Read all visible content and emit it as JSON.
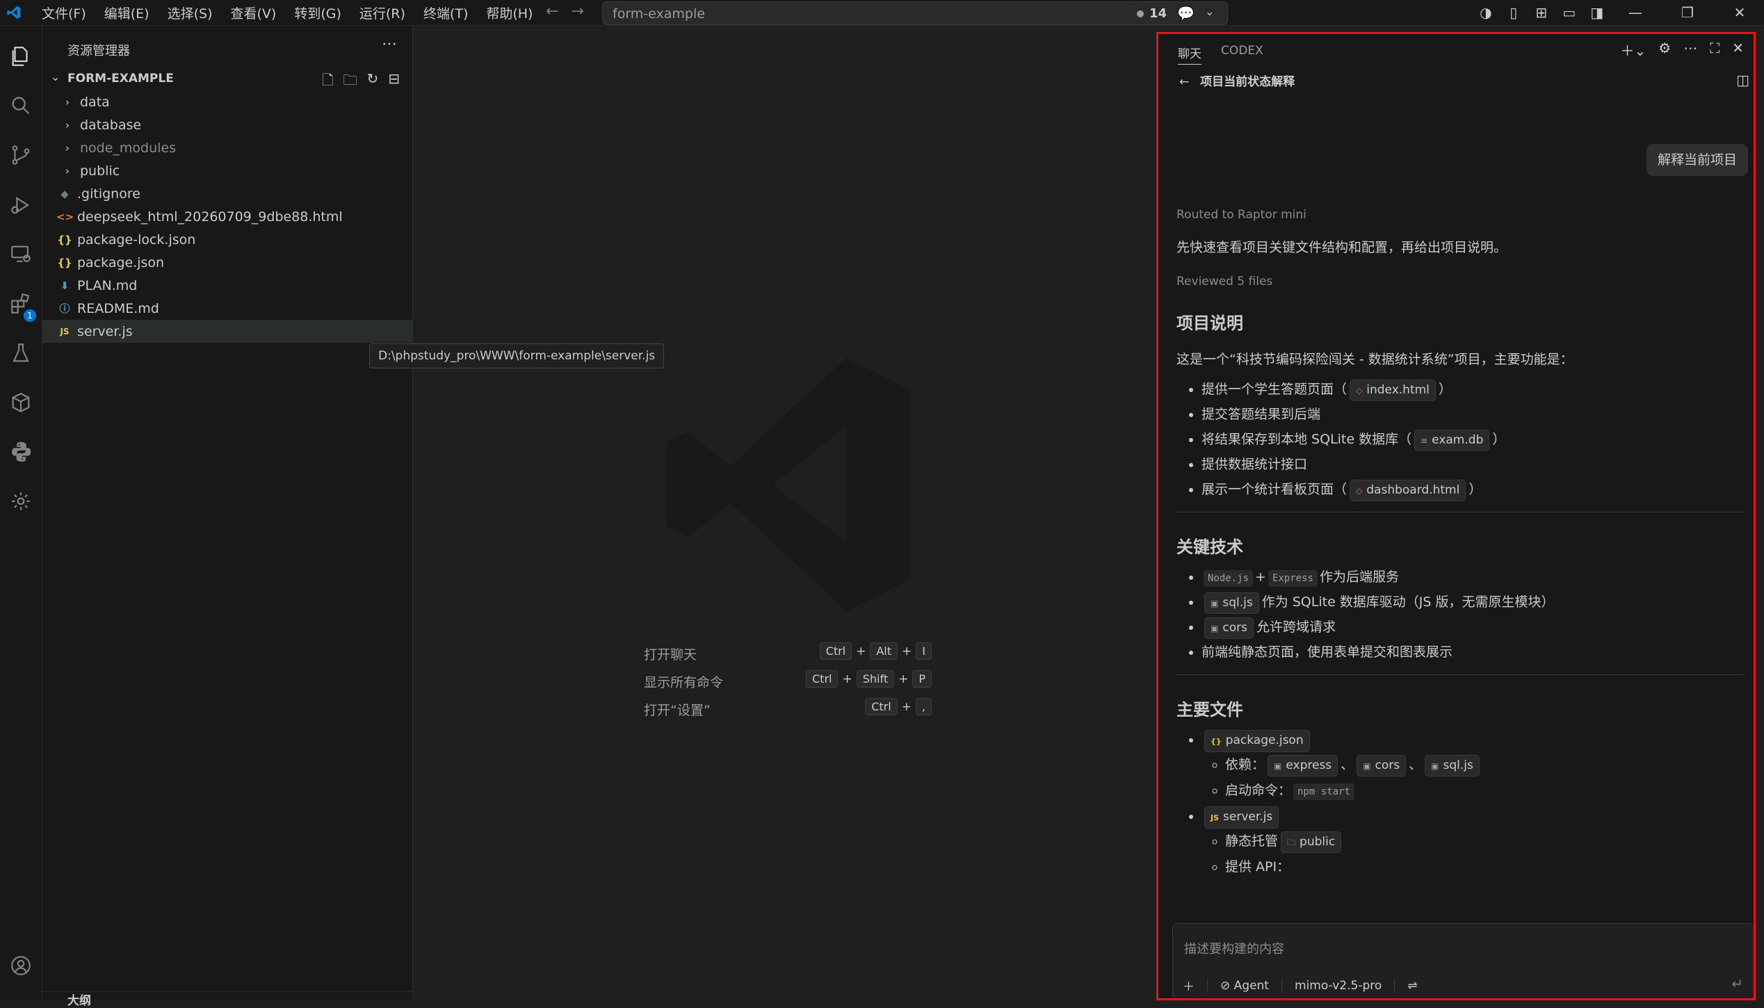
{
  "menu": [
    "文件(F)",
    "编辑(E)",
    "选择(S)",
    "查看(V)",
    "转到(G)",
    "运行(R)",
    "终端(T)",
    "帮助(H)"
  ],
  "command_center": {
    "query": "form-example",
    "badge_count": "14"
  },
  "activity_badge": "1",
  "explorer": {
    "title": "资源管理器",
    "section": "FORM-EXAMPLE",
    "items": [
      {
        "label": "data",
        "type": "folder"
      },
      {
        "label": "database",
        "type": "folder"
      },
      {
        "label": "node_modules",
        "type": "folder"
      },
      {
        "label": "public",
        "type": "folder"
      },
      {
        "label": ".gitignore",
        "type": "file"
      },
      {
        "label": "deepseek_html_20260709_9dbe88.html",
        "type": "file"
      },
      {
        "label": "package-lock.json",
        "type": "file"
      },
      {
        "label": "package.json",
        "type": "file"
      },
      {
        "label": "PLAN.md",
        "type": "file"
      },
      {
        "label": "README.md",
        "type": "file"
      },
      {
        "label": "server.js",
        "type": "file",
        "selected": true
      }
    ],
    "tooltip": "D:\\phpstudy_pro\\WWW\\form-example\\server.js",
    "outline_label": "大纲"
  },
  "editor": {
    "hints": [
      {
        "label": "打开聊天",
        "keys": [
          "Ctrl",
          "Alt",
          "I"
        ]
      },
      {
        "label": "显示所有命令",
        "keys": [
          "Ctrl",
          "Shift",
          "P"
        ]
      },
      {
        "label": "打开“设置”",
        "keys": [
          "Ctrl",
          ","
        ]
      }
    ],
    "key_plus": "+"
  },
  "chat": {
    "tab_chat": "聊天",
    "tab_codex": "CODEX",
    "conversation_title": "项目当前状态解释",
    "user_message": "解释当前项目",
    "routed": "Routed to Raptor mini",
    "intro": "先快速查看项目关键文件结构和配置，再给出项目说明。",
    "reviewed": "Reviewed 5 files",
    "s1": {
      "heading": "项目说明",
      "desc": "这是一个“科技节编码探险闯关 - 数据统计系统”项目，主要功能是：",
      "b1_text": "提供一个学生答题页面（",
      "b1_chip": "index.html",
      "b1_end": "）",
      "b2": "提交答题结果到后端",
      "b3_text": "将结果保存到本地 SQLite 数据库（",
      "b3_chip": "exam.db",
      "b3_end": "）",
      "b4": "提供数据统计接口",
      "b5_text": "展示一个统计看板页面（",
      "b5_chip": "dashboard.html",
      "b5_end": "）"
    },
    "s2": {
      "heading": "关键技术",
      "b1_code1": "Node.js",
      "b1_plus": "+",
      "b1_code2": "Express",
      "b1_text": "作为后端服务",
      "b2_chip": "sql.js",
      "b2_text": "作为 SQLite 数据库驱动（JS 版，无需原生模块）",
      "b3_chip": "cors",
      "b3_text": "允许跨域请求",
      "b4": "前端纯静态页面，使用表单提交和图表展示"
    },
    "s3": {
      "heading": "主要文件",
      "f1_chip": "package.json",
      "f1_dep_label": "依赖：",
      "f1_dep1": "express",
      "f1_dep2": "cors",
      "f1_dep3": "sql.js",
      "f1_sep": "、",
      "f1_start_label": "启动命令：",
      "f1_start_code": "npm start",
      "f2_chip": "server.js",
      "f2_static_label": "静态托管",
      "f2_static_chip": "public",
      "f2_api_label": "提供 API："
    },
    "input": {
      "placeholder": "描述要构建的内容",
      "mode": "Agent",
      "model": "mimo-v2.5-pro"
    }
  },
  "colors": {
    "accent": "#0078d4",
    "highlight_border": "#e5141b",
    "json_icon": "#e8c94a",
    "html_icon": "#e06c4a"
  }
}
